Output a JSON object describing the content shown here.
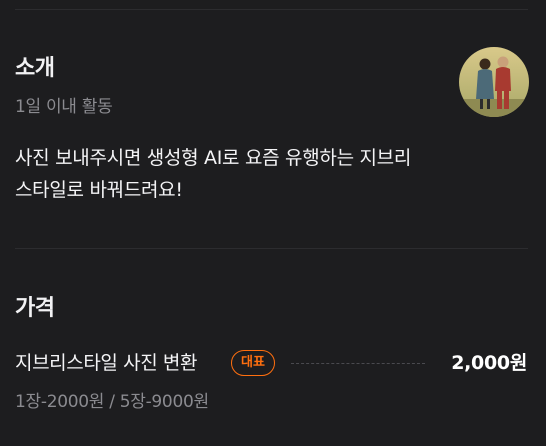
{
  "intro": {
    "title": "소개",
    "activity": "1일 이내 활동",
    "description": "사진 보내주시면 생성형 AI로 요즘 유행하는 지브리\n스타일로 바꿔드려요!",
    "avatar_icon": "profile-photo-couple"
  },
  "pricing": {
    "title": "가격",
    "items": [
      {
        "name": "지브리스타일 사진 변환",
        "badge": "대표",
        "price": "2,000원",
        "detail": "1장-2000원 / 5장-9000원"
      }
    ]
  },
  "colors": {
    "background": "#1d1d1f",
    "badge_accent": "#ff6f0f",
    "secondary_text": "#8b8b90"
  }
}
